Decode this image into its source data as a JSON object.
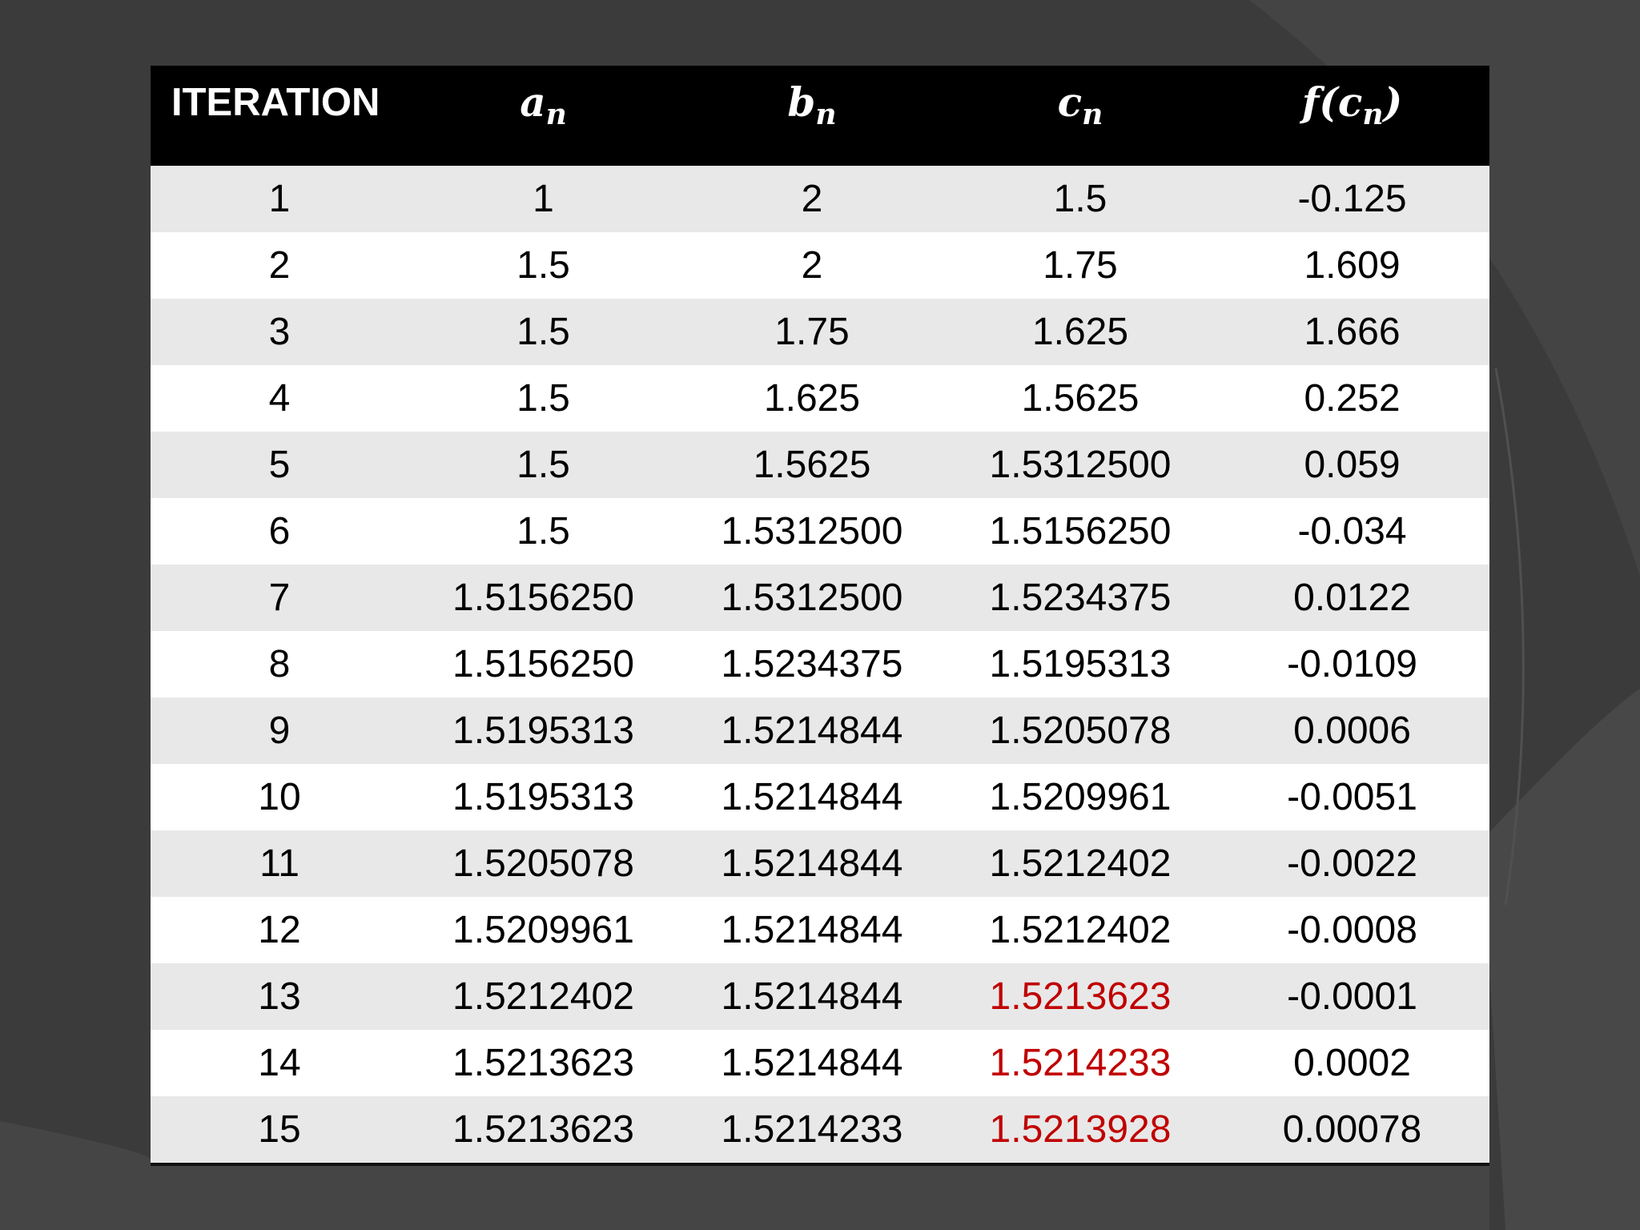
{
  "chart_data": {
    "type": "table",
    "columns": [
      {
        "label": "ITERATION"
      },
      {
        "symbol": "a",
        "sub": "n"
      },
      {
        "symbol": "b",
        "sub": "n"
      },
      {
        "symbol": "c",
        "sub": "n"
      },
      {
        "symbol": "f(c",
        "sub": "n",
        "suffix": ")"
      }
    ],
    "rows": [
      [
        "1",
        "1",
        "2",
        "1.5",
        "-0.125"
      ],
      [
        "2",
        "1.5",
        "2",
        "1.75",
        "1.609"
      ],
      [
        "3",
        "1.5",
        "1.75",
        "1.625",
        "1.666"
      ],
      [
        "4",
        "1.5",
        "1.625",
        "1.5625",
        "0.252"
      ],
      [
        "5",
        "1.5",
        "1.5625",
        "1.5312500",
        "0.059"
      ],
      [
        "6",
        "1.5",
        "1.5312500",
        "1.5156250",
        "-0.034"
      ],
      [
        "7",
        "1.5156250",
        "1.5312500",
        "1.5234375",
        "0.0122"
      ],
      [
        "8",
        "1.5156250",
        "1.5234375",
        "1.5195313",
        "-0.0109"
      ],
      [
        "9",
        "1.5195313",
        "1.5214844",
        "1.5205078",
        "0.0006"
      ],
      [
        "10",
        "1.5195313",
        "1.5214844",
        "1.5209961",
        "-0.0051"
      ],
      [
        "11",
        "1.5205078",
        "1.5214844",
        "1.5212402",
        "-0.0022"
      ],
      [
        "12",
        "1.5209961",
        "1.5214844",
        "1.5212402",
        "-0.0008"
      ],
      [
        "13",
        "1.5212402",
        "1.5214844",
        "1.5213623",
        "-0.0001"
      ],
      [
        "14",
        "1.5213623",
        "1.5214844",
        "1.5214233",
        "0.0002"
      ],
      [
        "15",
        "1.5213623",
        "1.5214233",
        "1.5213928",
        "0.00078"
      ]
    ],
    "highlight": {
      "column": 3,
      "rows": [
        12,
        13,
        14
      ],
      "color": "#c00000"
    }
  },
  "colors": {
    "background": "#3d3d3d",
    "header_bg": "#000000",
    "header_text": "#ffffff",
    "row_odd": "#e8e8e8",
    "row_even": "#ffffff",
    "highlight": "#c00000"
  }
}
